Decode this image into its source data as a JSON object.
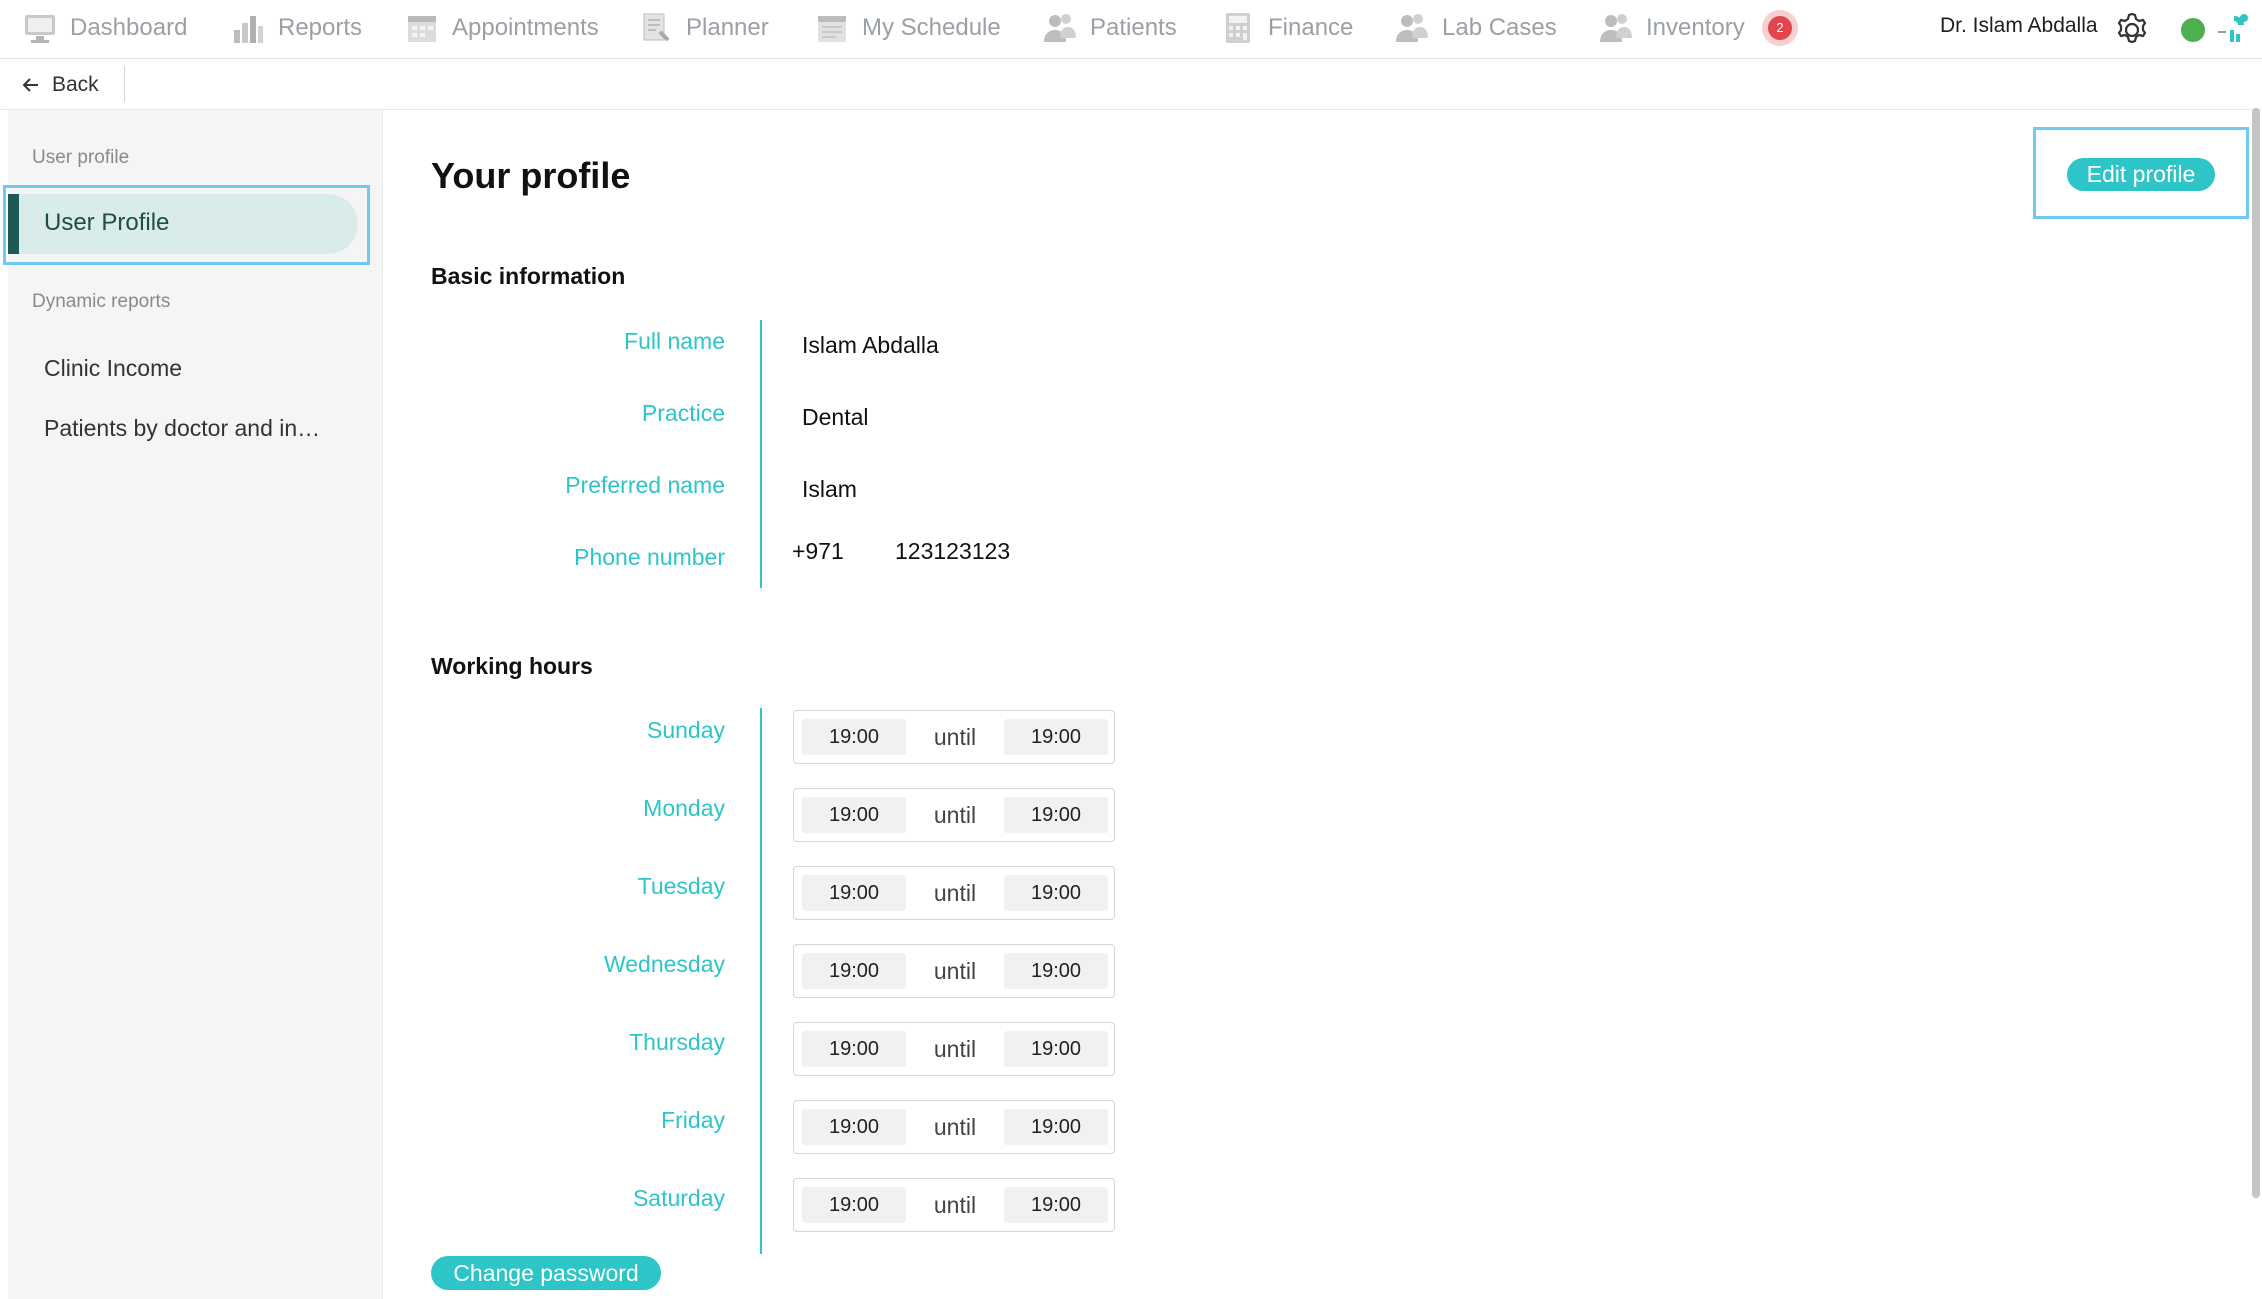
{
  "nav": {
    "items": [
      {
        "label": "Dashboard",
        "icon": "monitor-icon"
      },
      {
        "label": "Reports",
        "icon": "bar-chart-icon"
      },
      {
        "label": "Appointments",
        "icon": "calendar-icon"
      },
      {
        "label": "Planner",
        "icon": "planner-icon"
      },
      {
        "label": "My Schedule",
        "icon": "schedule-icon"
      },
      {
        "label": "Patients",
        "icon": "people-icon"
      },
      {
        "label": "Finance",
        "icon": "calculator-icon"
      },
      {
        "label": "Lab Cases",
        "icon": "lab-people-icon"
      },
      {
        "label": "Inventory",
        "icon": "inventory-people-icon"
      }
    ],
    "notification_count": "2",
    "user_name": "Dr. Islam Abdalla",
    "status_color": "#4caf50"
  },
  "back": {
    "label": "Back"
  },
  "sidebar": {
    "section_profile": "User profile",
    "active_item": "User Profile",
    "section_reports": "Dynamic reports",
    "items": [
      "Clinic Income",
      "Patients by doctor and in…"
    ]
  },
  "main": {
    "title": "Your profile",
    "edit_button": "Edit profile",
    "basic_heading": "Basic information",
    "fields": {
      "full_name_label": "Full name",
      "full_name_value": "Islam Abdalla",
      "practice_label": "Practice",
      "practice_value": "Dental",
      "preferred_label": "Preferred name",
      "preferred_value": "Islam",
      "phone_label": "Phone number",
      "phone_code": "+971",
      "phone_value": "123123123"
    },
    "hours_heading": "Working hours",
    "until_label": "until",
    "days": [
      {
        "day": "Sunday",
        "from": "19:00",
        "to": "19:00"
      },
      {
        "day": "Monday",
        "from": "19:00",
        "to": "19:00"
      },
      {
        "day": "Tuesday",
        "from": "19:00",
        "to": "19:00"
      },
      {
        "day": "Wednesday",
        "from": "19:00",
        "to": "19:00"
      },
      {
        "day": "Thursday",
        "from": "19:00",
        "to": "19:00"
      },
      {
        "day": "Friday",
        "from": "19:00",
        "to": "19:00"
      },
      {
        "day": "Saturday",
        "from": "19:00",
        "to": "19:00"
      }
    ],
    "change_password": "Change password"
  },
  "colors": {
    "accent": "#2dc5c8",
    "active_bar": "#1c5a58",
    "highlight": "#72c9ef",
    "badge": "#e2454b"
  }
}
